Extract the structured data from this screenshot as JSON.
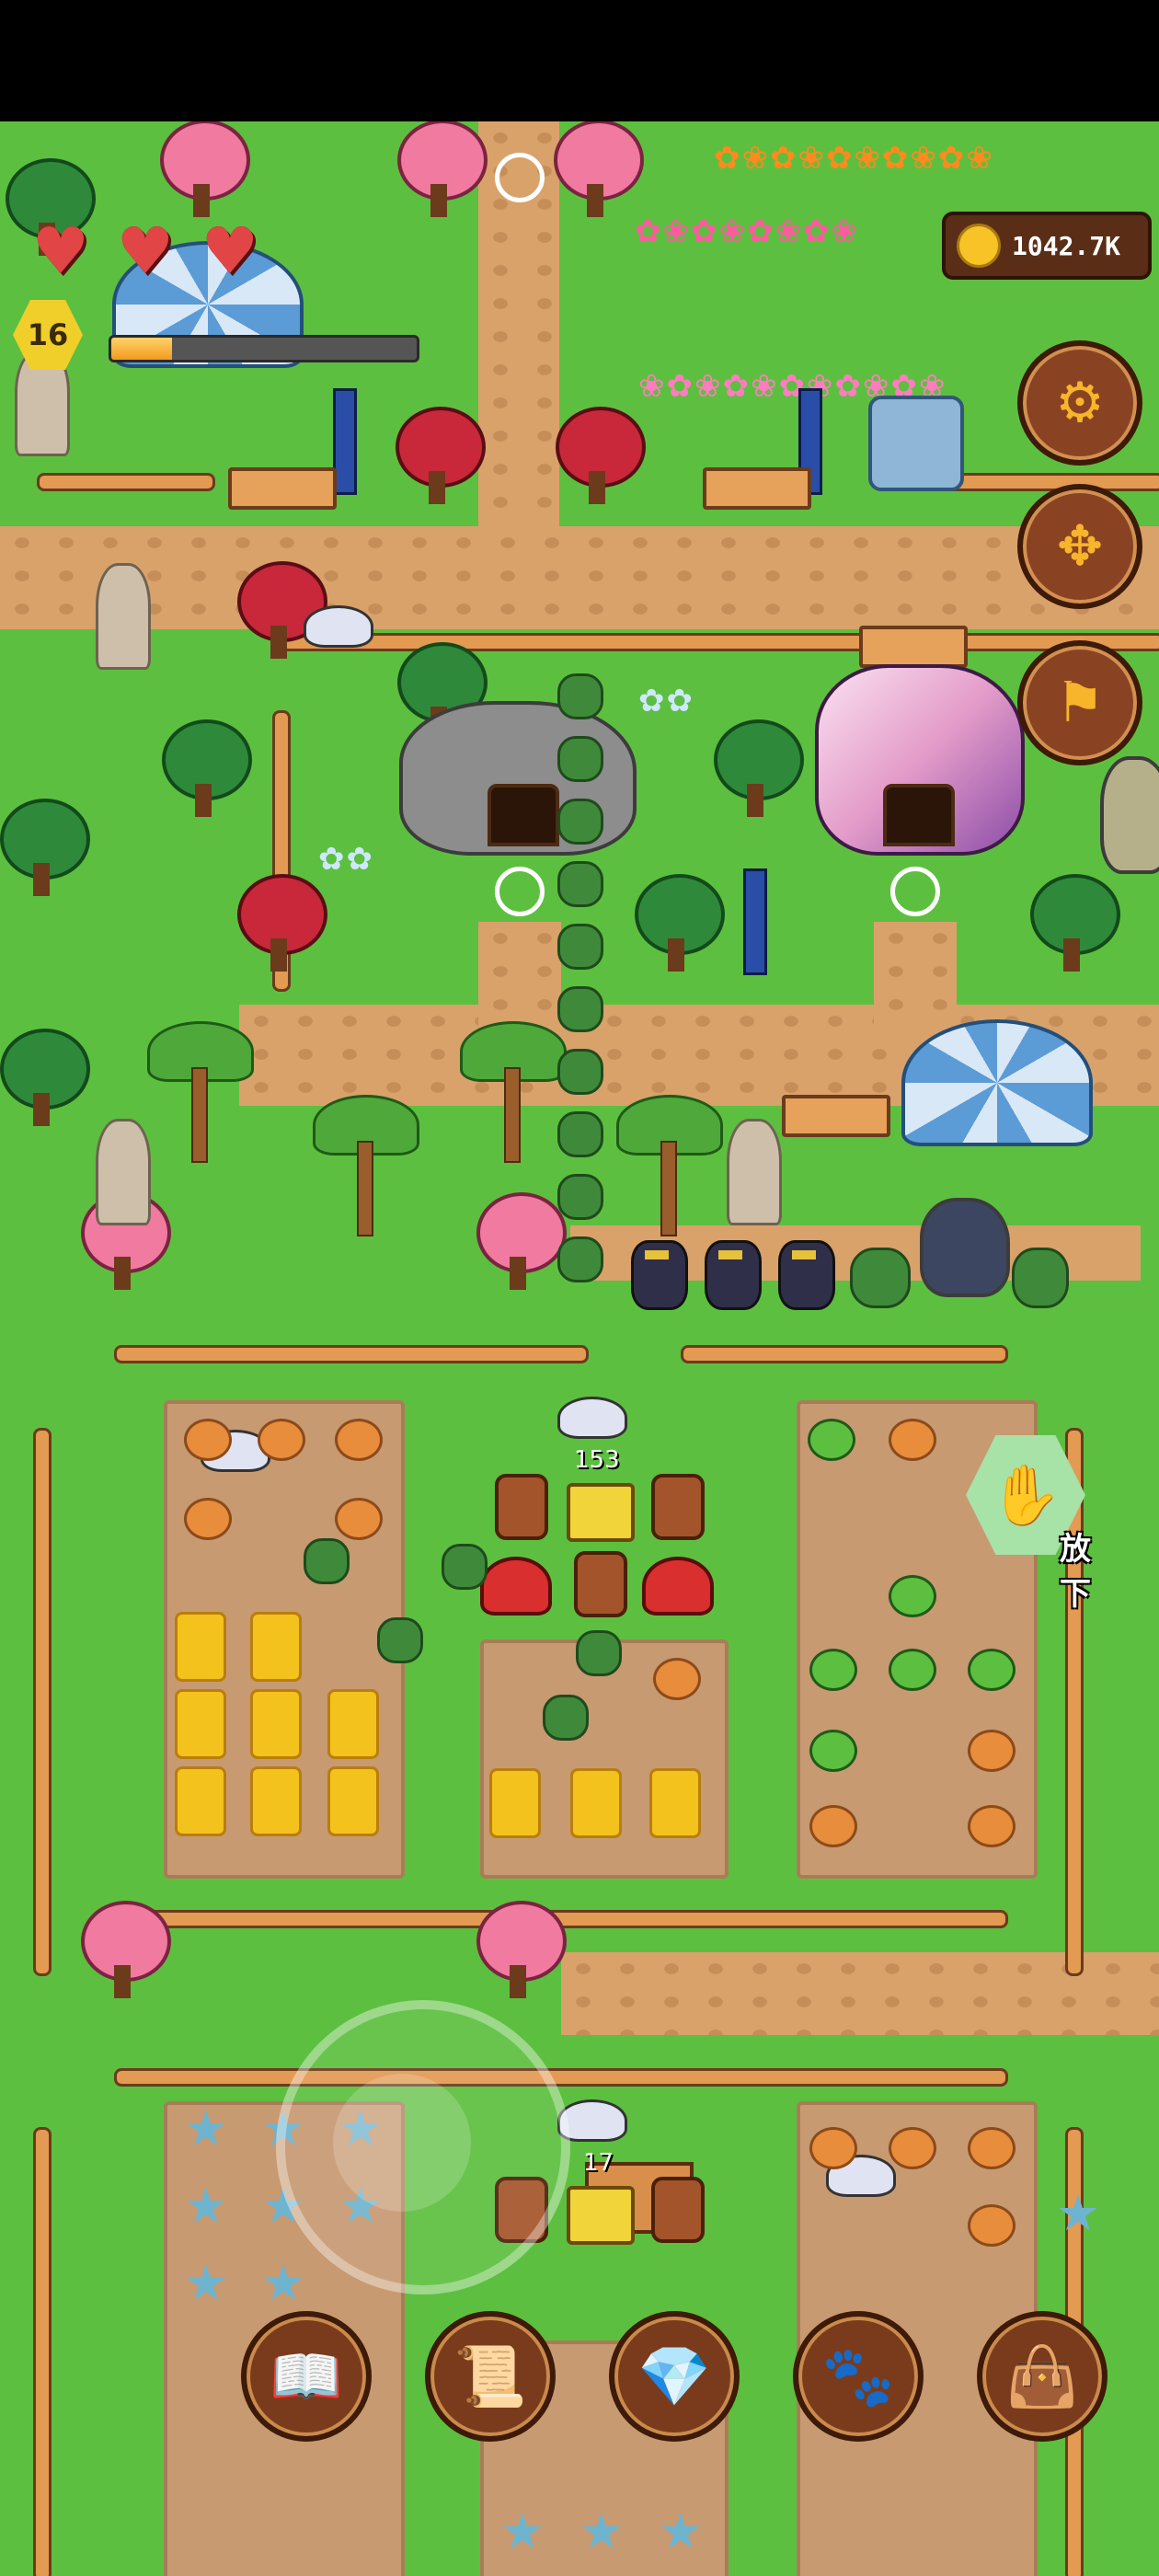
{
  "hud": {
    "hearts": [
      {
        "icon": "heart-icon",
        "glyph": "♥"
      },
      {
        "icon": "heart-icon",
        "glyph": "♥"
      },
      {
        "icon": "heart-icon",
        "glyph": "♥"
      }
    ],
    "level": "16",
    "xp_progress": 0.2,
    "coins": "1042.7K",
    "colors": {
      "heart": "#e14545",
      "xp_fill": "#f39a1e",
      "coin": "#f7c327"
    }
  },
  "side_buttons": [
    {
      "icon": "gear-icon",
      "glyph": "⚙"
    },
    {
      "icon": "move-arrows-icon",
      "glyph": "✥"
    },
    {
      "icon": "flag-icon",
      "glyph": "⚑"
    }
  ],
  "putdown": {
    "icon": "glove-hand-icon",
    "glyph": "✋",
    "label": "放下"
  },
  "field_counts": {
    "top_chest": "153",
    "bottom_chest": "17"
  },
  "bottom_bar": [
    {
      "icon": "book-icon",
      "glyph": "📖"
    },
    {
      "icon": "map-scroll-icon",
      "glyph": "📜"
    },
    {
      "icon": "gem-coin-shop-icon",
      "glyph": "💎"
    },
    {
      "icon": "paw-icon",
      "glyph": "🐾"
    },
    {
      "icon": "leather-bag-icon",
      "glyph": "👜"
    }
  ]
}
